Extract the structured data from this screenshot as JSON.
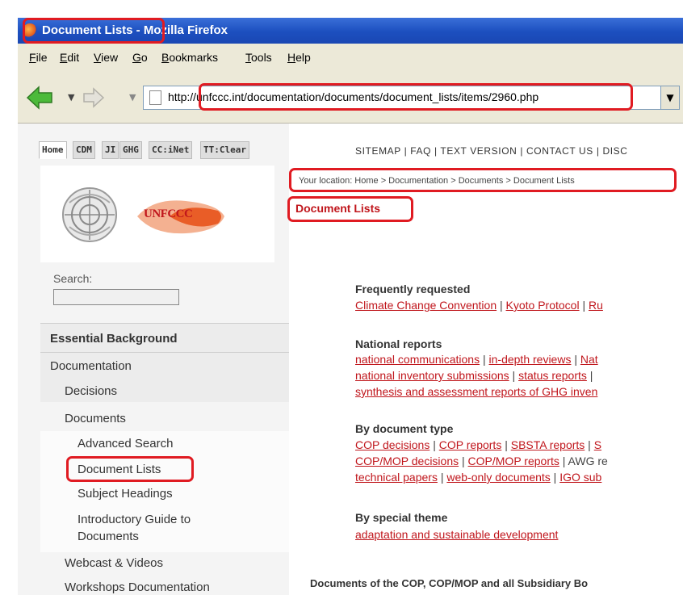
{
  "window": {
    "title": "Document Lists - Mozilla Firefox"
  },
  "menu": [
    "File",
    "Edit",
    "View",
    "Go",
    "Bookmarks",
    "Tools",
    "Help"
  ],
  "toolbar": {
    "url": "http://unfccc.int/documentation/documents/document_lists/items/2960.php"
  },
  "tabs": [
    "Home",
    "CDM",
    "JI",
    "GHG",
    "CC:iNet",
    "TT:Clear"
  ],
  "logo": {
    "text": "UNFCCC"
  },
  "search": {
    "label": "Search:"
  },
  "sidebar": {
    "essential": "Essential Background",
    "documentation": "Documentation",
    "decisions": "Decisions",
    "documents": "Documents",
    "advanced_search": "Advanced Search",
    "document_lists": "Document Lists",
    "subject_headings": "Subject Headings",
    "intro_guide_1": "Introductory Guide to",
    "intro_guide_2": "Documents",
    "webcast": "Webcast & Videos",
    "workshops": "Workshops Documentation"
  },
  "topnav": "SITEMAP | FAQ | TEXT VERSION | CONTACT US | DISC",
  "breadcrumb": "Your location: Home  > Documentation  > Documents  > Document Lists",
  "page_title": "Document Lists",
  "sections": {
    "frequent": {
      "heading": "Frequently requested",
      "links": [
        "Climate Change Convention",
        "Kyoto Protocol",
        "Ru"
      ]
    },
    "national": {
      "heading": "National reports",
      "line1": [
        "national communications",
        "in-depth reviews",
        "Nat"
      ],
      "line2": [
        "national inventory submissions",
        "status reports"
      ],
      "line3": [
        "synthesis and assessment reports of GHG inven"
      ]
    },
    "bytype": {
      "heading": "By document type",
      "line1": [
        "COP decisions",
        "COP reports",
        "SBSTA reports",
        "S"
      ],
      "line2": [
        "COP/MOP decisions",
        "COP/MOP reports"
      ],
      "line2_plain": "AWG re",
      "line3": [
        "technical papers",
        "web-only documents",
        "IGO sub"
      ]
    },
    "theme": {
      "heading": "By special theme",
      "link": "adaptation and sustainable development"
    }
  },
  "bottom": "Documents of the COP, COP/MOP and all Subsidiary Bo",
  "colors": {
    "accent_red": "#c0161c",
    "highlight": "#e01b22",
    "titlebar": "#1c4fbf"
  }
}
